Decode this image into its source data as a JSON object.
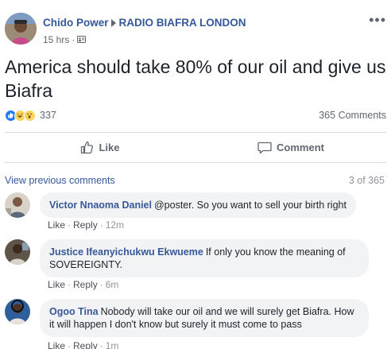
{
  "post": {
    "author": "Chido Power",
    "group": "RADIO BIAFRA LONDON",
    "time": "15 hrs",
    "privacy_icon": "group-members-icon",
    "more_label": "•••",
    "text": "America should take 80% of our oil and give us Biafra",
    "reaction_count": "337",
    "comment_count": "365 Comments",
    "reactions": [
      "like",
      "haha",
      "wow"
    ]
  },
  "actions": {
    "like_label": "Like",
    "comment_label": "Comment"
  },
  "comments_section": {
    "view_previous": "View previous comments",
    "page_count": "3 of 365"
  },
  "comments": [
    {
      "author": "Victor Nnaoma Daniel",
      "text": "@poster. So you want to sell your birth right",
      "like": "Like",
      "reply": "Reply",
      "time": "12m"
    },
    {
      "author": "Justice Ifeanyichukwu Ekwueme",
      "text": "If only you know the meaning of SOVEREIGNTY.",
      "like": "Like",
      "reply": "Reply",
      "time": "6m"
    },
    {
      "author": "Ogoo Tina",
      "text": "Nobody will take our oil and we will surely get Biafra. How it will happen I don't know but surely it must come to pass",
      "like": "Like",
      "reply": "Reply",
      "time": "1m"
    }
  ],
  "colors": {
    "link_blue": "#365899",
    "like_blue": "#2078f4",
    "reaction_yellow": "#fcd35c",
    "bubble_gray": "#f2f3f5",
    "text_gray": "#606770"
  }
}
